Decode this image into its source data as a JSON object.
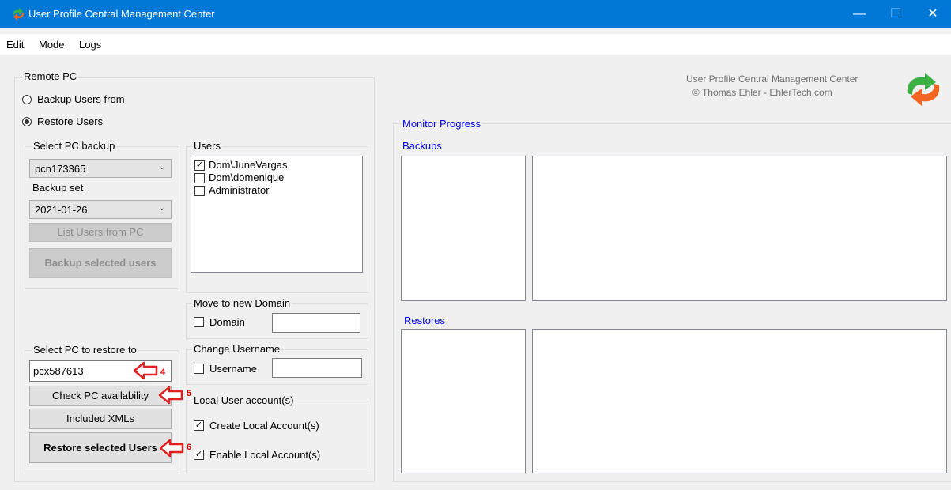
{
  "window": {
    "title": "User Profile Central Management Center",
    "minimize_glyph": "—",
    "maximize_glyph": "☐",
    "close_glyph": "✕",
    "accent_color": "#0078d7"
  },
  "menu": {
    "items": [
      "Edit",
      "Mode",
      "Logs"
    ]
  },
  "remote_pc": {
    "title": "Remote PC",
    "radio_backup": "Backup Users from",
    "radio_restore": "Restore Users",
    "selected": "Restore Users"
  },
  "select_backup": {
    "title": "Select PC backup",
    "pc_value": "pcn173365",
    "backup_set_label": "Backup set",
    "backup_set_value": "2021-01-26",
    "list_users_button": "List Users from PC",
    "backup_selected_button": "Backup selected users"
  },
  "users": {
    "title": "Users",
    "items": [
      {
        "label": "Dom\\JuneVargas",
        "checked": "✓"
      },
      {
        "label": "Dom\\domenique",
        "checked": ""
      },
      {
        "label": "Administrator",
        "checked": ""
      }
    ]
  },
  "move_domain": {
    "title": "Move to new Domain",
    "checkbox_label": "Domain",
    "value": ""
  },
  "change_username": {
    "title": "Change Username",
    "checkbox_label": "Username",
    "value": ""
  },
  "restore_target": {
    "title": "Select PC to restore to",
    "pc_value": "pcx587613",
    "check_button": "Check PC availability",
    "included_button": "Included XMLs",
    "restore_button": "Restore selected Users"
  },
  "local_account": {
    "title": "Local User account(s)",
    "create_label": "Create Local Account(s)",
    "create_checked": "✓",
    "enable_label": "Enable Local Account(s)",
    "enable_checked": "✓"
  },
  "branding": {
    "line1": "User Profile Central Management Center",
    "line2": "© Thomas Ehler - EhlerTech.com"
  },
  "monitor": {
    "title": "Monitor Progress",
    "backups_label": "Backups",
    "restores_label": "Restores"
  },
  "annotations": {
    "m4": "4",
    "m5": "5",
    "m6": "6",
    "arrow_color": "#e02020"
  }
}
